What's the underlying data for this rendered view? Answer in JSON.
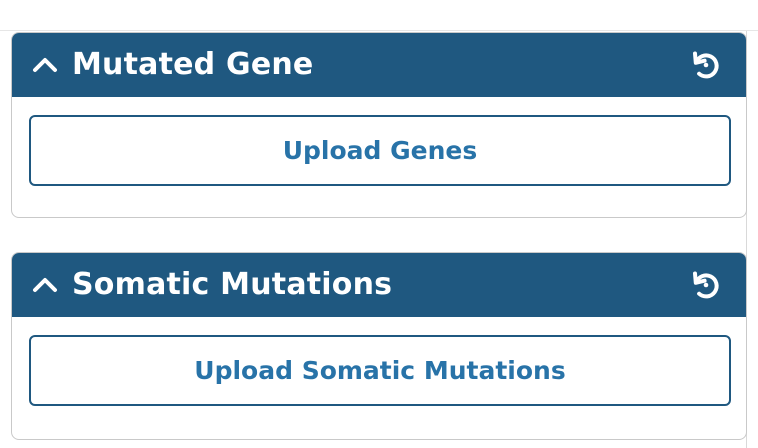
{
  "colors": {
    "header_background": "#1f5880",
    "header_text": "#ffffff",
    "button_border": "#1f5880",
    "button_text": "#2873a8"
  },
  "cards": [
    {
      "title": "Mutated Gene",
      "toggle_icon": "chevron-up-icon",
      "reset_icon": "reset-icon",
      "upload_label": "Upload Genes"
    },
    {
      "title": "Somatic Mutations",
      "toggle_icon": "chevron-up-icon",
      "reset_icon": "reset-icon",
      "upload_label": "Upload Somatic Mutations"
    }
  ]
}
